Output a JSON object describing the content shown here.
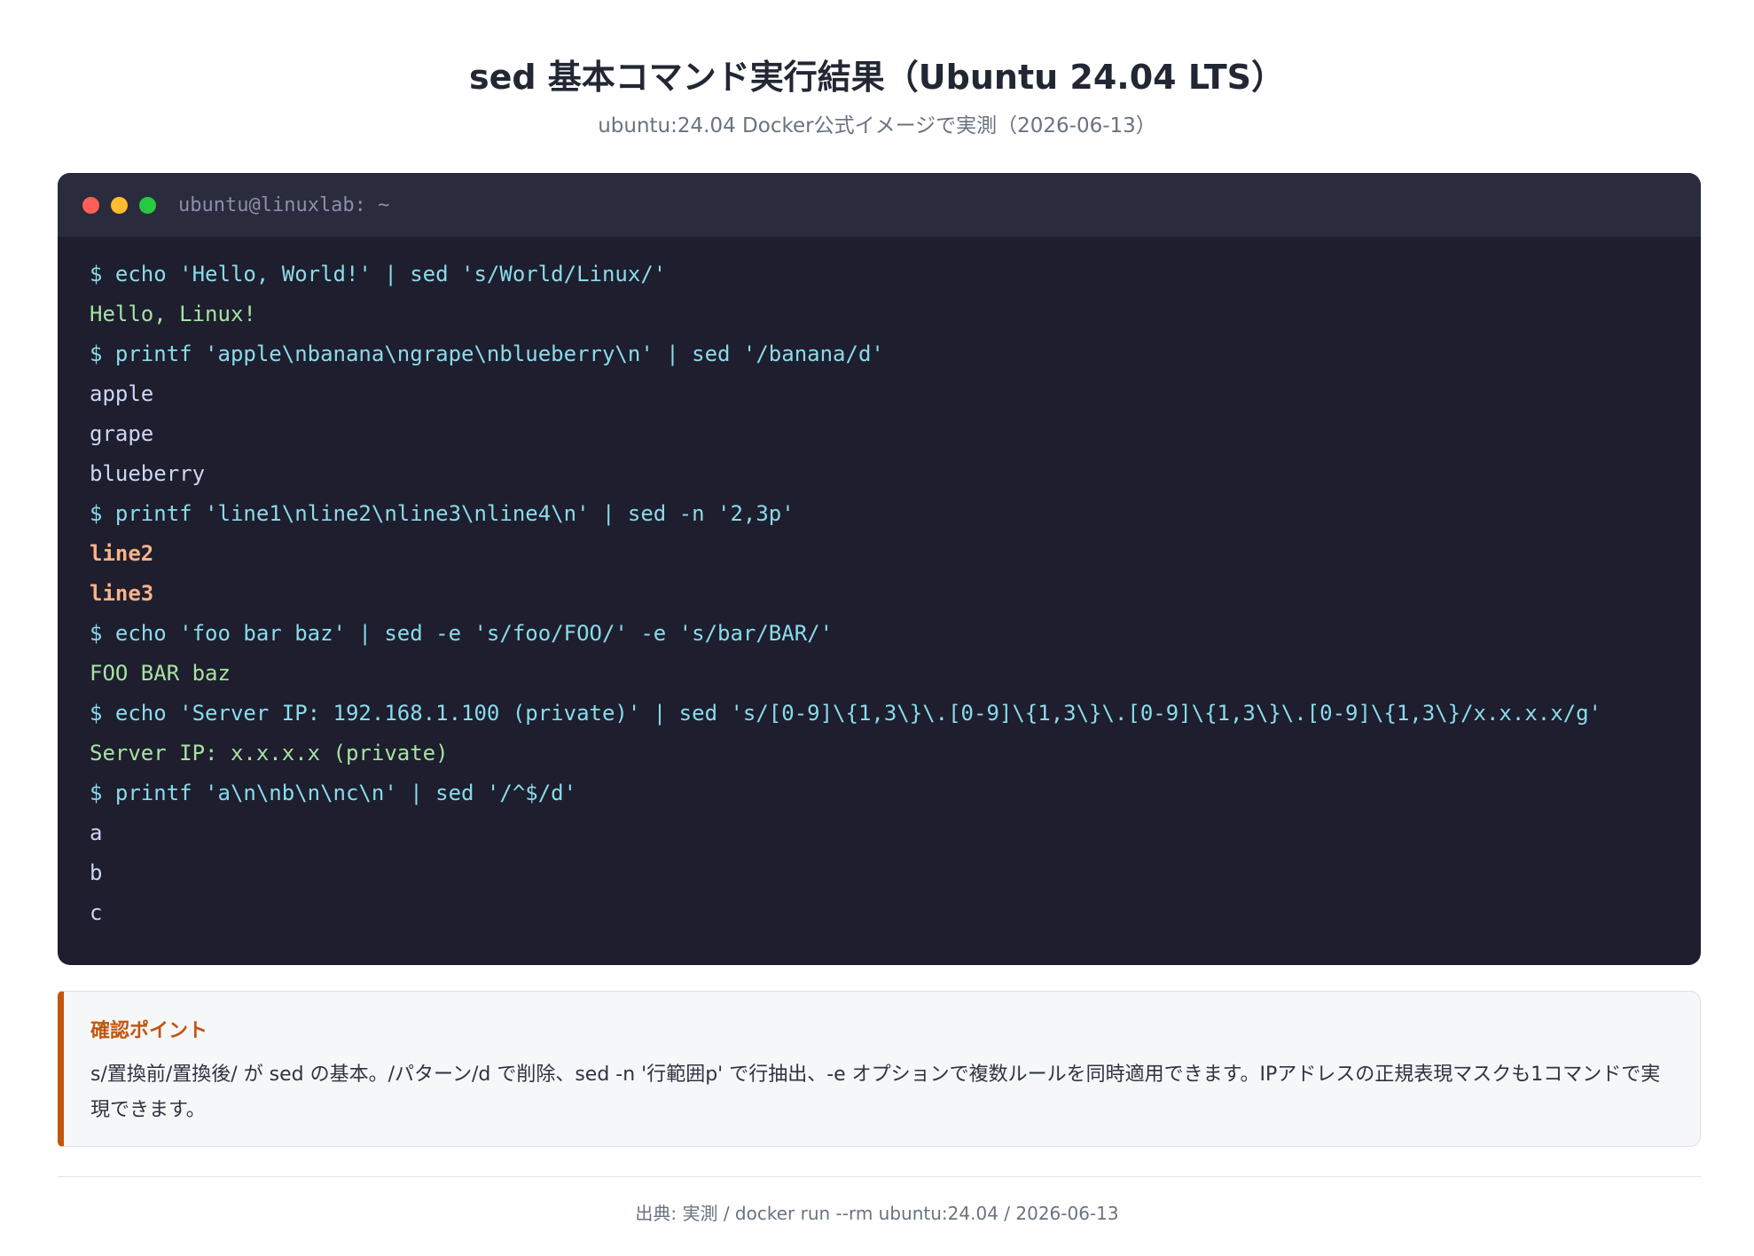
{
  "header": {
    "title": "sed 基本コマンド実行結果（Ubuntu 24.04 LTS）",
    "subtitle": "ubuntu:24.04 Docker公式イメージで実測（2026-06-13）"
  },
  "terminal": {
    "window_title": "ubuntu@linuxlab: ~",
    "lines": [
      {
        "kind": "cmd",
        "text": "$ echo 'Hello, World!' | sed 's/World/Linux/'"
      },
      {
        "kind": "out-green",
        "text": "Hello, Linux!"
      },
      {
        "kind": "cmd",
        "text": "$ printf 'apple\\nbanana\\ngrape\\nblueberry\\n' | sed '/banana/d'"
      },
      {
        "kind": "out-plain",
        "text": "apple"
      },
      {
        "kind": "out-plain",
        "text": "grape"
      },
      {
        "kind": "out-plain",
        "text": "blueberry"
      },
      {
        "kind": "cmd",
        "text": "$ printf 'line1\\nline2\\nline3\\nline4\\n' | sed -n '2,3p'"
      },
      {
        "kind": "out-bold",
        "text": "line2"
      },
      {
        "kind": "out-bold",
        "text": "line3"
      },
      {
        "kind": "cmd",
        "text": "$ echo 'foo bar baz' | sed -e 's/foo/FOO/' -e 's/bar/BAR/'"
      },
      {
        "kind": "out-green",
        "text": "FOO BAR baz"
      },
      {
        "kind": "cmd",
        "text": "$ echo 'Server IP: 192.168.1.100 (private)' | sed 's/[0-9]\\{1,3\\}\\.[0-9]\\{1,3\\}\\.[0-9]\\{1,3\\}\\.[0-9]\\{1,3\\}/x.x.x.x/g'"
      },
      {
        "kind": "out-green",
        "text": "Server IP: x.x.x.x (private)"
      },
      {
        "kind": "cmd",
        "text": "$ printf 'a\\n\\nb\\n\\nc\\n' | sed '/^$/d'"
      },
      {
        "kind": "out-plain",
        "text": "a"
      },
      {
        "kind": "out-plain",
        "text": "b"
      },
      {
        "kind": "out-plain",
        "text": "c"
      }
    ]
  },
  "note": {
    "title": "確認ポイント",
    "body": "s/置換前/置換後/ が sed の基本。/パターン/d で削除、sed -n '行範囲p' で行抽出、-e オプションで複数ルールを同時適用できます。IPアドレスの正規表現マスクも1コマンドで実現できます。"
  },
  "footer": {
    "text": "出典: 実測 / docker run --rm ubuntu:24.04 / 2026-06-13"
  },
  "colors": {
    "terminal_bg": "#1e1e2e",
    "titlebar_bg": "#2a2b3d",
    "command": "#89dceb",
    "output_green": "#a6e3a1",
    "output_plain": "#cdd6f4",
    "output_highlight": "#fab387",
    "accent": "#c2560e"
  }
}
